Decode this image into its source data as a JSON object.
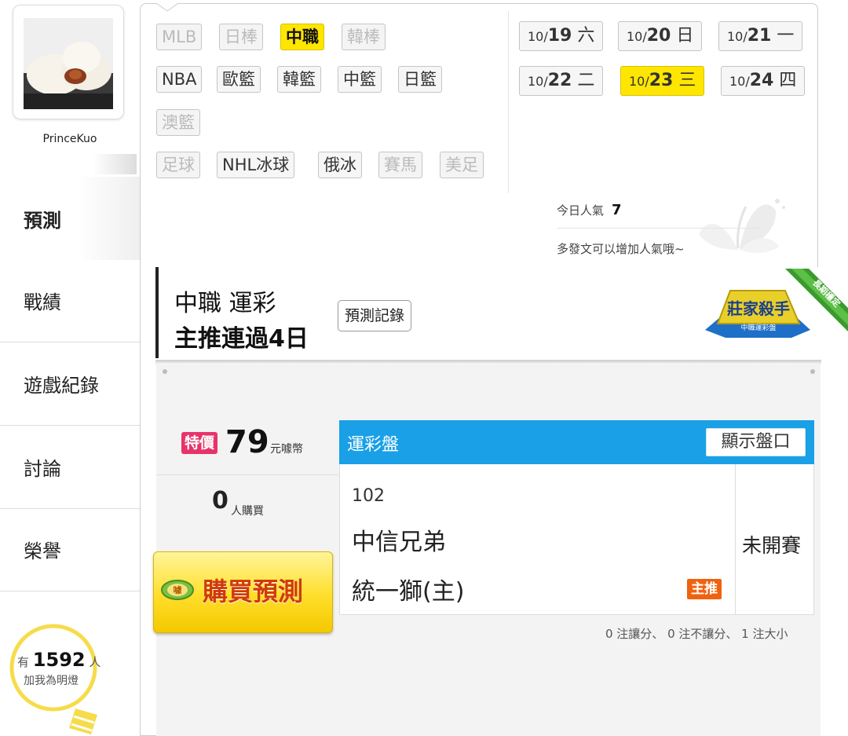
{
  "user": {
    "name": "PrinceKuo"
  },
  "nav": {
    "items": [
      {
        "label": "預測",
        "active": true
      },
      {
        "label": "戰績",
        "active": false
      },
      {
        "label": "遊戲紀錄",
        "active": false
      },
      {
        "label": "討論",
        "active": false
      },
      {
        "label": "榮譽",
        "active": false
      }
    ]
  },
  "fans": {
    "prefix": "有",
    "count": "1592",
    "suffix": "人",
    "caption": "加我為明燈"
  },
  "leagues": [
    {
      "label": "MLB",
      "state": "dim"
    },
    {
      "label": "日棒",
      "state": "dim"
    },
    {
      "label": "中職",
      "state": "selected"
    },
    {
      "label": "韓棒",
      "state": "dim"
    },
    {
      "label": "NBA",
      "state": "normal"
    },
    {
      "label": "歐籃",
      "state": "normal"
    },
    {
      "label": "韓籃",
      "state": "normal"
    },
    {
      "label": "中籃",
      "state": "normal"
    },
    {
      "label": "日籃",
      "state": "normal"
    },
    {
      "label": "澳籃",
      "state": "dim"
    },
    {
      "label": "足球",
      "state": "dim"
    },
    {
      "label": "NHL冰球",
      "state": "normal"
    },
    {
      "label": "俄冰",
      "state": "normal"
    },
    {
      "label": "賽馬",
      "state": "dim"
    },
    {
      "label": "美足",
      "state": "dim"
    }
  ],
  "dates": [
    {
      "md": "10/",
      "day": "19",
      "wd": "六",
      "selected": false
    },
    {
      "md": "10/",
      "day": "20",
      "wd": "日",
      "selected": false
    },
    {
      "md": "10/",
      "day": "21",
      "wd": "一",
      "selected": false
    },
    {
      "md": "10/",
      "day": "22",
      "wd": "二",
      "selected": false
    },
    {
      "md": "10/",
      "day": "23",
      "wd": "三",
      "selected": true
    },
    {
      "md": "10/",
      "day": "24",
      "wd": "四",
      "selected": false
    }
  ],
  "popularity": {
    "label": "今日人氣",
    "value": "7",
    "hint": "多發文可以增加人氣哦~"
  },
  "banner": {
    "line1": "中職 運彩",
    "line2": "主推連過4日",
    "record_button": "預測記錄",
    "badge_title": "莊家殺手",
    "badge_sub": "中職運彩盤",
    "ribbon": "長期穩定"
  },
  "offer": {
    "sale_tag": "特價",
    "price": "79",
    "price_unit": "元噱幣",
    "buyers": "0",
    "buyers_unit": "人購買",
    "buy_button": "購買預測",
    "coin_label": "噱"
  },
  "table": {
    "title": "運彩盤",
    "show_button": "顯示盤口",
    "game_no": "102",
    "team_away": "中信兄弟",
    "team_home": "統一獅(主)",
    "main_tag": "主推",
    "status": "未開賽",
    "summary": "0 注讓分、 0 注不讓分、 1 注大小"
  },
  "colors": {
    "accent": "#1aa0e6",
    "selected": "#ffe600",
    "sale": "#e6346b",
    "main_tag": "#f0620f",
    "buy_text": "#d03a0c"
  }
}
